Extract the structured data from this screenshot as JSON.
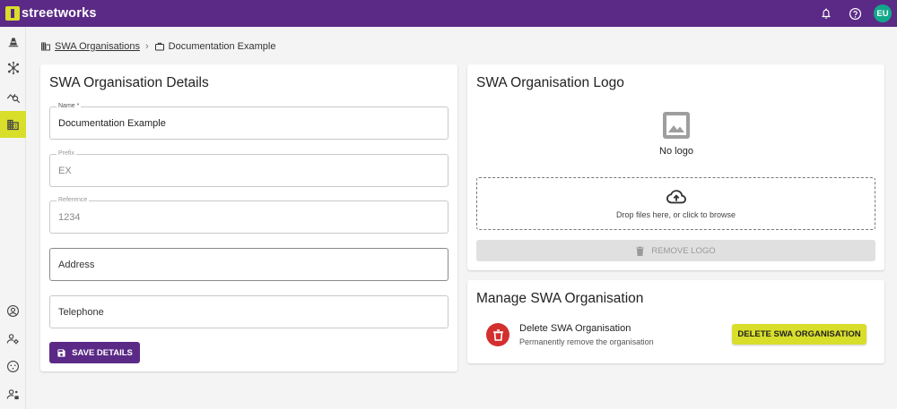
{
  "app": {
    "brand_digit": "1",
    "brand_name": "streetworks"
  },
  "colors": {
    "primary": "#5b2a86",
    "accent": "#d8de2a",
    "avatar": "#11a88a",
    "danger": "#d32f2f"
  },
  "header": {
    "icons": [
      "bell-icon",
      "help-icon"
    ],
    "avatar_initials": "EU"
  },
  "sidebar": {
    "items": [
      {
        "icon": "cone-icon",
        "active": false
      },
      {
        "icon": "network-icon",
        "active": false
      },
      {
        "icon": "analytics-icon",
        "active": false
      },
      {
        "icon": "organisation-icon",
        "active": true
      }
    ],
    "bottom_items": [
      {
        "icon": "account-icon"
      },
      {
        "icon": "users-icon"
      },
      {
        "icon": "face-icon"
      },
      {
        "icon": "user-settings-icon"
      }
    ]
  },
  "breadcrumb": {
    "parent": "SWA Organisations",
    "current": "Documentation Example"
  },
  "details": {
    "title": "SWA Organisation Details",
    "name": {
      "label": "Name *",
      "value": "Documentation Example"
    },
    "prefix": {
      "label": "Prefix",
      "value": "EX"
    },
    "reference": {
      "label": "Reference",
      "value": "1234"
    },
    "address": {
      "placeholder": "Address"
    },
    "telephone": {
      "placeholder": "Telephone"
    },
    "save_label": "SAVE DETAILS"
  },
  "logo": {
    "title": "SWA Organisation Logo",
    "no_logo": "No logo",
    "drop_text": "Drop files here, or click to browse",
    "remove_label": "REMOVE LOGO"
  },
  "manage": {
    "title": "Manage SWA Organisation",
    "delete_title": "Delete SWA Organisation",
    "delete_subtitle": "Permanently remove the organisation",
    "delete_button": "DELETE SWA ORGANISATION"
  }
}
